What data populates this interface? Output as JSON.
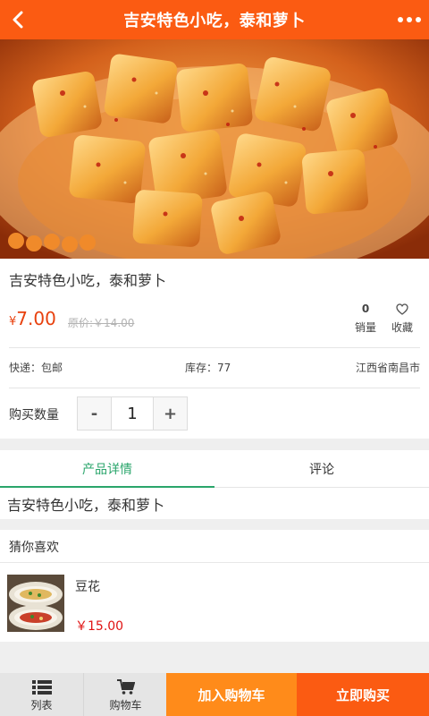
{
  "header": {
    "title": "吉安特色小吃，泰和萝卜",
    "back_icon": "chevron-left-icon",
    "more_icon": "more-dots-icon",
    "bg_color": "#fb5b12"
  },
  "product": {
    "name": "吉安特色小吃，泰和萝卜",
    "price_symbol": "¥",
    "price": "7.00",
    "original_price": "原价:￥14.00",
    "sales_count": "0",
    "sales_label": "销量",
    "favorite_label": "收藏",
    "shipping": "快递：包邮",
    "stock": "库存：77",
    "location": "江西省南昌市",
    "quantity_label": "购买数量",
    "quantity_value": "1",
    "minus_label": "-",
    "plus_label": "+"
  },
  "tabs": [
    {
      "label": "产品详情",
      "active": true
    },
    {
      "label": "评论",
      "active": false
    }
  ],
  "detail_text": "吉安特色小吃，泰和萝卜",
  "recommend": {
    "title": "猜你喜欢",
    "items": [
      {
        "name": "豆花",
        "price": "￥15.00"
      }
    ]
  },
  "bottom_bar": {
    "list_label": "列表",
    "list_icon": "list-icon",
    "cart_label": "购物车",
    "cart_icon": "cart-icon",
    "add_to_cart_label": "加入购物车",
    "buy_now_label": "立即购买",
    "accent_orange": "#ff8b1a",
    "accent_red": "#fb5b12"
  }
}
